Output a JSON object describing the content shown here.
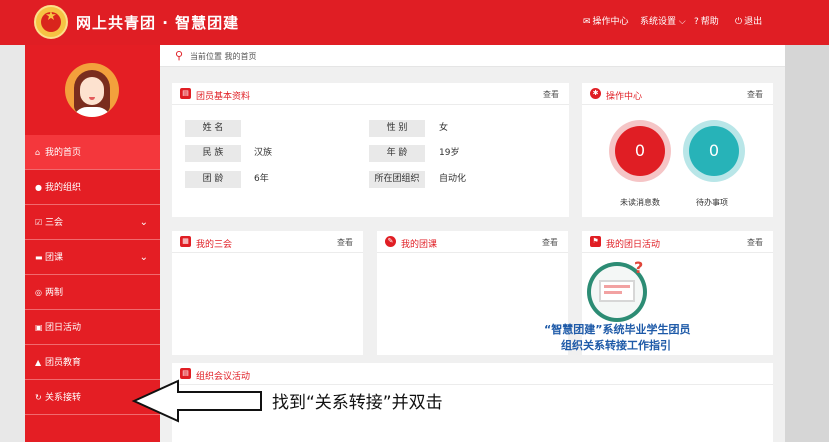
{
  "header": {
    "title": "网上共青团 · 智慧团建",
    "nav": [
      {
        "icon": "envelope-icon",
        "glyph": "✉",
        "label": "操作中心"
      },
      {
        "icon": "chevron-down-icon",
        "glyph": "⌵",
        "label": "系统设置"
      },
      {
        "icon": "help-icon",
        "glyph": "?",
        "label": "帮助"
      },
      {
        "icon": "power-icon",
        "glyph": "⏻",
        "label": "退出"
      }
    ]
  },
  "sidebar": {
    "items": [
      {
        "icon": "home-icon",
        "glyph": "⌂",
        "label": "我的首页"
      },
      {
        "icon": "group-icon",
        "glyph": "●",
        "label": "我的组织"
      },
      {
        "icon": "checkbox-icon",
        "glyph": "☑",
        "label": "三会"
      },
      {
        "icon": "folder-icon",
        "glyph": "▬",
        "label": "团课"
      },
      {
        "icon": "target-icon",
        "glyph": "◎",
        "label": "两制"
      },
      {
        "icon": "calendar-icon",
        "glyph": "▣",
        "label": "团日活动"
      },
      {
        "icon": "graduation-cap-icon",
        "glyph": "▲",
        "label": "团员教育"
      },
      {
        "icon": "refresh-icon",
        "glyph": "↻",
        "label": "关系接转"
      }
    ]
  },
  "breadcrumb": {
    "text": "当前位置 我的首页"
  },
  "profile": {
    "title": "团员基本资料",
    "view_label": "查看",
    "rows": [
      {
        "label": "姓 名",
        "value": "",
        "label2": "性 别",
        "value2": "女"
      },
      {
        "label": "民 族",
        "value": "汉族",
        "label2": "年 龄",
        "value2": "19岁"
      },
      {
        "label": "团 龄",
        "value": "6年",
        "label2": "所在团组织",
        "value2": "自动化"
      }
    ]
  },
  "ops": {
    "title": "操作中心",
    "view_label": "查看",
    "unread_count": "0",
    "unread_label": "未读消息数",
    "todo_count": "0",
    "todo_label": "待办事项"
  },
  "panels": {
    "sanhui": {
      "title": "我的三会",
      "view_label": "查看"
    },
    "tuanke": {
      "title": "我的团课",
      "view_label": "查看"
    },
    "tuanri": {
      "title": "我的团日活动",
      "view_label": "查看"
    },
    "meeting": {
      "title": "组织会议活动"
    }
  },
  "promo": {
    "line1": "“智慧团建”系统毕业学生团员",
    "line2": "组织关系转接工作指引"
  },
  "annotation": {
    "text": "找到“关系转接”并双击"
  },
  "colors": {
    "brand_red": "#e01e24",
    "teal": "#27b3b8",
    "ring": "#f5c5c6"
  }
}
